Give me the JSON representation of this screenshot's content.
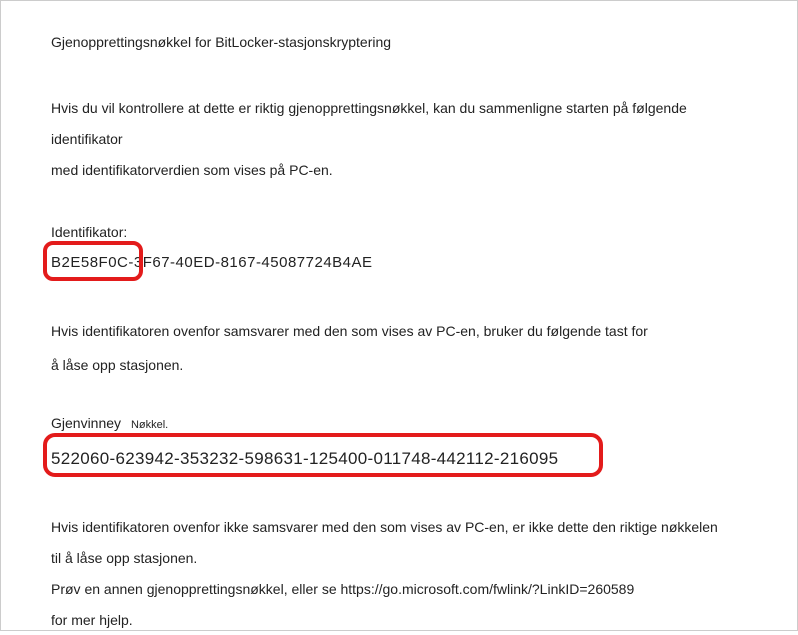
{
  "title": "Gjenopprettingsnøkkel for BitLocker-stasjonskryptering",
  "instruction_top_line1": "Hvis du vil kontrollere at dette er riktig gjenopprettingsnøkkel, kan du sammenligne starten på følgende identifikator",
  "instruction_top_line2": "med identifikatorverdien som vises på PC-en.",
  "identifier_label": "Identifikator:",
  "identifier_value": "B2E58F0C-3F67-40ED-8167-45087724B4AE",
  "instruction_mid_line1": "Hvis identifikatoren ovenfor samsvarer med den som vises av PC-en, bruker du følgende tast for",
  "instruction_mid_line2": "å låse opp stasjonen.",
  "recovery_label_part1": "Gjenvinney",
  "recovery_label_part2": "Nøkkel.",
  "recovery_key": "522060-623942-353232-598631-125400-011748-442112-216095",
  "instruction_bottom_line1": "Hvis identifikatoren ovenfor ikke samsvarer med den som vises av PC-en, er ikke dette den riktige nøkkelen",
  "instruction_bottom_line2": "til å låse opp stasjonen.",
  "instruction_bottom_line3": "Prøv en annen gjenopprettingsnøkkel, eller se https://go.microsoft.com/fwlink/?LinkID=260589",
  "instruction_bottom_line4": "for mer hjelp."
}
